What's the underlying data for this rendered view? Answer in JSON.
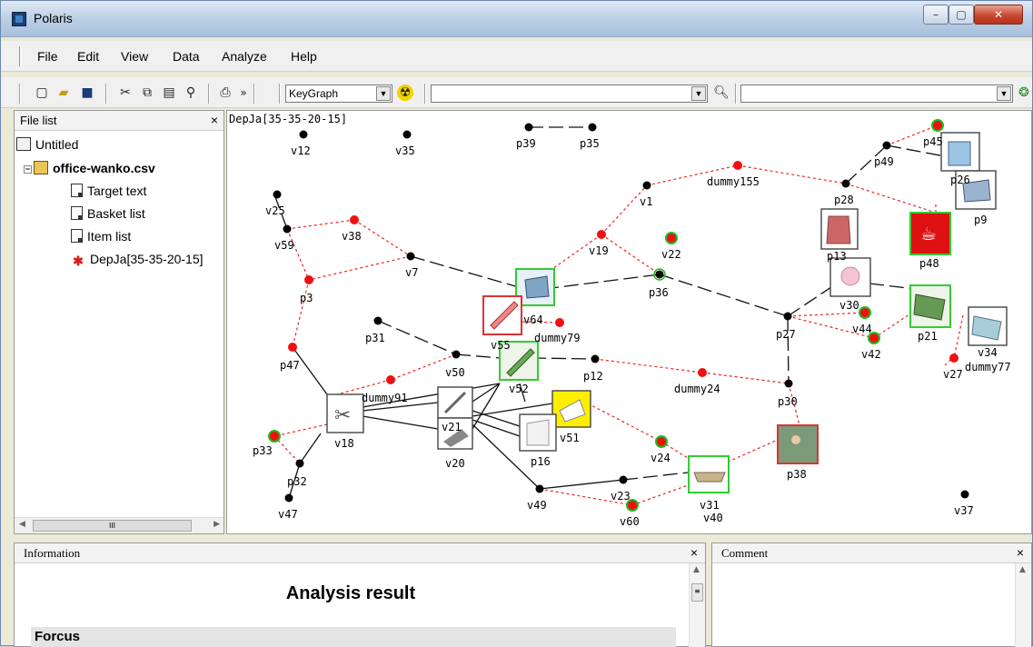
{
  "window": {
    "title": "Polaris",
    "min": "–",
    "max": "▢",
    "close": "✕"
  },
  "menu": [
    "File",
    "Edit",
    "View",
    "Data",
    "Analyze",
    "Help"
  ],
  "toolbar": {
    "algorithm": "KeyGraph",
    "dropdown_arrow": "▼",
    "text_box_value": "",
    "search_box_value": "",
    "icons": [
      "new-icon",
      "open-icon",
      "save-icon",
      "cut-icon",
      "copy-icon",
      "paste-icon",
      "find-icon",
      "print-icon",
      "more-icon",
      "run-icon",
      "preview-icon",
      "settings-icon"
    ],
    "more": "»"
  },
  "file_list": {
    "title": "File list",
    "close": "×",
    "items": [
      {
        "label": "Untitled"
      },
      {
        "label": "office-wanko.csv"
      },
      {
        "label": "Target text"
      },
      {
        "label": "Basket list"
      },
      {
        "label": "Item list"
      },
      {
        "label": "DepJa[35-35-20-15]"
      }
    ],
    "scroll_grip": "III"
  },
  "graph": {
    "label": "DepJa[35-35-20-15]",
    "colors": {
      "black_node": "#000000",
      "red_node": "#ee1111",
      "green_ring": "#22bb22",
      "red_link": "#ee2222",
      "image_border_green": "#33cc33",
      "image_border_red": "#dd3333"
    },
    "nodes": [
      "v12",
      "v35",
      "p39",
      "p35",
      "p45",
      "p49",
      "p26",
      "p28",
      "p9",
      "dummy155",
      "v1",
      "v25",
      "v59",
      "v38",
      "v7",
      "p3",
      "v19",
      "v22",
      "p36",
      "p13",
      "p48",
      "v64",
      "v55",
      "dummy79",
      "p31",
      "v50",
      "p47",
      "v52",
      "p12",
      "dummy24",
      "p27",
      "p30",
      "v30",
      "v44",
      "v42",
      "p21",
      "v34",
      "v27",
      "dummy77",
      "dummy91",
      "v18",
      "v21",
      "v20",
      "v51",
      "p16",
      "p33",
      "p32",
      "v47",
      "v24",
      "p38",
      "v31",
      "v40",
      "v49",
      "v23",
      "v60",
      "v37"
    ]
  },
  "information": {
    "title": "Information",
    "close": "×",
    "heading": "Analysis result",
    "section": "Forcus"
  },
  "comment": {
    "title": "Comment",
    "close": "×"
  }
}
